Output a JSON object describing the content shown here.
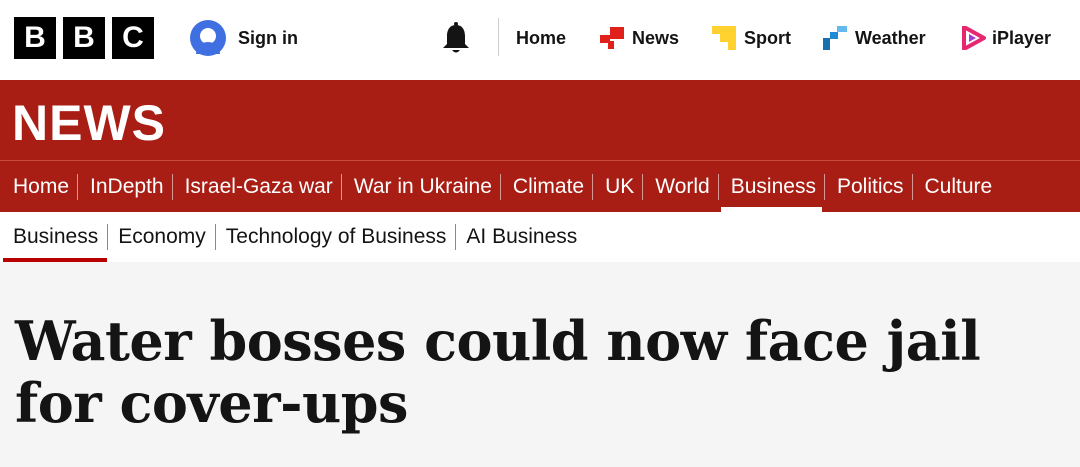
{
  "brand": {
    "letters": [
      "B",
      "B",
      "C"
    ]
  },
  "account": {
    "signin_label": "Sign in"
  },
  "global_nav": [
    {
      "label": "Home",
      "icon": "home",
      "color": ""
    },
    {
      "label": "News",
      "icon": "news-icon",
      "color": "#e0201b"
    },
    {
      "label": "Sport",
      "icon": "sport-icon",
      "color": "#ffd230"
    },
    {
      "label": "Weather",
      "icon": "weather-icon",
      "color": "#1f8ad6"
    },
    {
      "label": "iPlayer",
      "icon": "iplayer-icon",
      "color": "#e6266f"
    }
  ],
  "section": {
    "title": "NEWS",
    "color": "#a81e15"
  },
  "main_nav": [
    "Home",
    "InDepth",
    "Israel-Gaza war",
    "War in Ukraine",
    "Climate",
    "UK",
    "World",
    "Business",
    "Politics",
    "Culture"
  ],
  "main_nav_active": "Business",
  "sub_nav": [
    "Business",
    "Economy",
    "Technology of Business",
    "AI Business"
  ],
  "sub_nav_active": "Business",
  "article": {
    "headline": "Water bosses could now face jail for cover-ups"
  }
}
